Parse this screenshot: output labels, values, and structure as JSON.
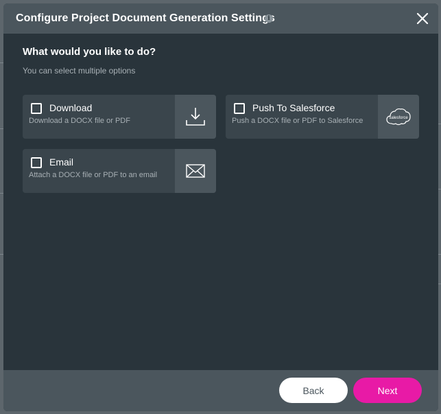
{
  "dialog": {
    "title": "Configure Project Document Generation Settings",
    "info_icon": "info-icon",
    "close_icon": "close-icon"
  },
  "prompt": {
    "question": "What would you like to do?",
    "hint": "You can select multiple options"
  },
  "options": [
    {
      "label": "Download",
      "description": "Download a DOCX file or PDF",
      "icon": "download-icon",
      "checked": false
    },
    {
      "label": "Push To Salesforce",
      "description": "Push a DOCX file or PDF to Salesforce",
      "icon": "salesforce-icon",
      "icon_text": "salesforce",
      "checked": false
    },
    {
      "label": "Email",
      "description": "Attach a DOCX file or PDF to an email",
      "icon": "envelope-icon",
      "checked": false
    }
  ],
  "footer": {
    "back_label": "Back",
    "next_label": "Next"
  },
  "colors": {
    "accent": "#e81aa6",
    "modal_bg": "#29343b",
    "header_bg": "#4b565d"
  }
}
